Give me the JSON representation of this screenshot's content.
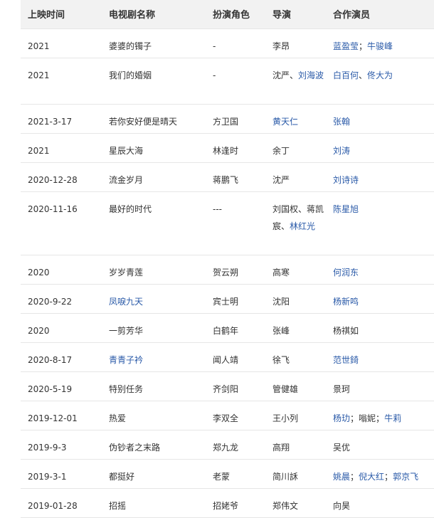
{
  "headers": [
    "上映时间",
    "电视剧名称",
    "扮演角色",
    "导演",
    "合作演员"
  ],
  "colors": {
    "link": "#2a5aa8",
    "text": "#333333",
    "header_bg": "#f2f2f2",
    "border": "#e6e6e6"
  },
  "rows": [
    {
      "date": "2021",
      "title": "婆婆的镯子",
      "role": "-",
      "director": "李昂",
      "costars": "蓝盈莹；牛骏峰"
    },
    {
      "date": "2021",
      "title": "我们的婚姻",
      "role": "-",
      "director": "沈严、刘海波",
      "costars": "白百何、佟大为"
    },
    {
      "date": "2021-3-17",
      "title": "若你安好便是晴天",
      "role": "方卫国",
      "director": "黄天仁",
      "costars": "张翰"
    },
    {
      "date": "2021",
      "title": "星辰大海",
      "role": "林逢时",
      "director": "余丁",
      "costars": "刘涛"
    },
    {
      "date": "2020-12-28",
      "title": "流金岁月",
      "role": "蒋鹏飞",
      "director": "沈严",
      "costars": "刘诗诗"
    },
    {
      "date": "2020-11-16",
      "title": "最好的时代",
      "role": "---",
      "director": "刘国权、蒋凯宸、林红光",
      "costars": "陈星旭"
    },
    {
      "date": "2020",
      "title": "岁岁青莲",
      "role": "贺云朔",
      "director": "高寒",
      "costars": "何润东"
    },
    {
      "date": "2020-9-22",
      "title": "凤唳九天",
      "role": "宾士明",
      "director": "沈阳",
      "costars": "杨新鸣"
    },
    {
      "date": "2020",
      "title": "一剪芳华",
      "role": "白鹤年",
      "director": "张峰",
      "costars": "杨祺如"
    },
    {
      "date": "2020-8-17",
      "title": "青青子衿",
      "role": "闻人靖",
      "director": "徐飞",
      "costars": "范世錡"
    },
    {
      "date": "2020-5-19",
      "title": "特别任务",
      "role": "齐剑阳",
      "director": "管健雄",
      "costars": "景珂"
    },
    {
      "date": "2019-12-01",
      "title": "热爱",
      "role": "李双全",
      "director": "王小列",
      "costars": "杨玏；嗡妮；牛莉"
    },
    {
      "date": "2019-9-3",
      "title": "伪钞者之末路",
      "role": "郑九龙",
      "director": "高翔",
      "costars": "吴优"
    },
    {
      "date": "2019-3-1",
      "title": "都挺好",
      "role": "老蒙",
      "director": "简川訸",
      "costars": "姚晨；倪大红；郭京飞"
    },
    {
      "date": "2019-01-28",
      "title": "招摇",
      "role": "招姥爷",
      "director": "郑伟文",
      "costars": "向昊"
    }
  ]
}
